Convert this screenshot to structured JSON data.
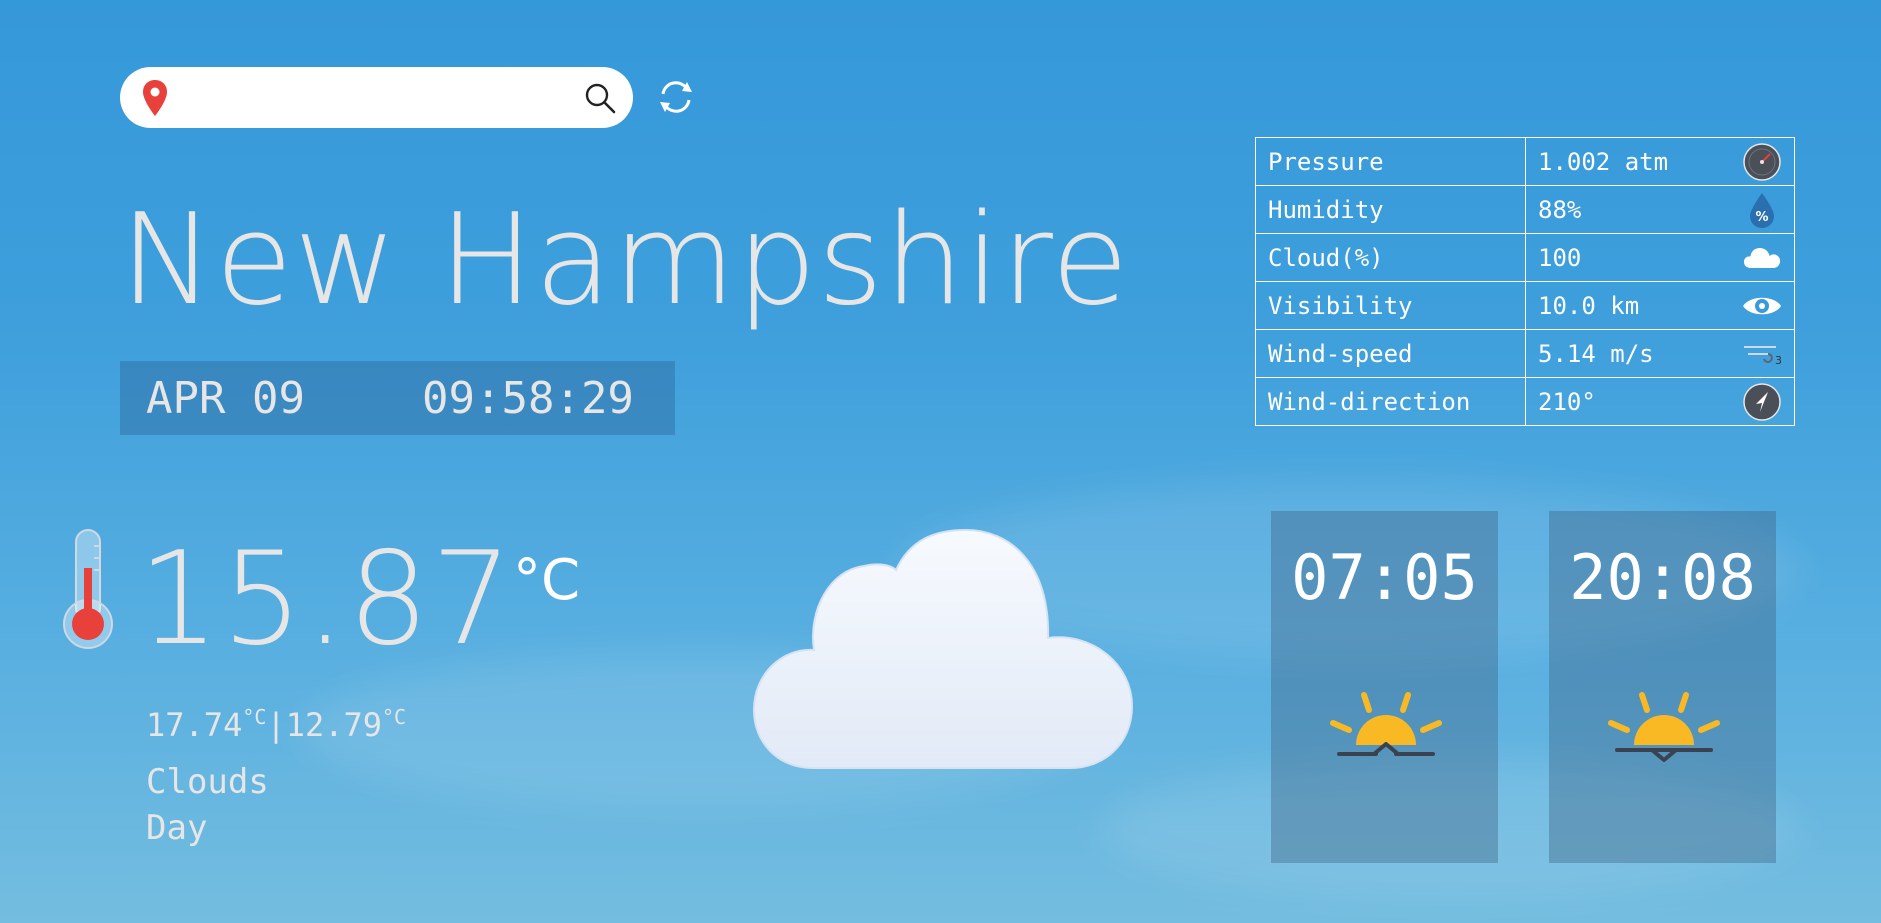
{
  "search": {
    "value": "",
    "placeholder": ""
  },
  "location": {
    "city": "New Hampshire"
  },
  "datetime": {
    "date": "APR 09",
    "time": "09:58:29"
  },
  "stats": [
    {
      "label": "Pressure",
      "value": "1.002 atm",
      "icon": "gauge-icon"
    },
    {
      "label": "Humidity",
      "value": "88%",
      "icon": "humidity-drop-icon"
    },
    {
      "label": "Cloud(%)",
      "value": "100",
      "icon": "cloud-icon"
    },
    {
      "label": "Visibility",
      "value": "10.0 km",
      "icon": "eye-icon"
    },
    {
      "label": "Wind-speed",
      "value": "5.14 m/s",
      "icon": "wind-icon"
    },
    {
      "label": "Wind-direction",
      "value": "210°",
      "icon": "compass-icon"
    }
  ],
  "weather": {
    "temp": "15.87",
    "unit": "°C",
    "max": "17.74",
    "min": "12.79",
    "min_max_unit": "°C",
    "separator": "|",
    "condition": "Clouds",
    "day_part": "Day"
  },
  "sun": {
    "sunrise": "07:05",
    "sunset": "20:08"
  },
  "colors": {
    "sky": "#3598d9",
    "sun": "#f9b925",
    "pin": "#e8413c",
    "thermometer": "#e8413c"
  }
}
